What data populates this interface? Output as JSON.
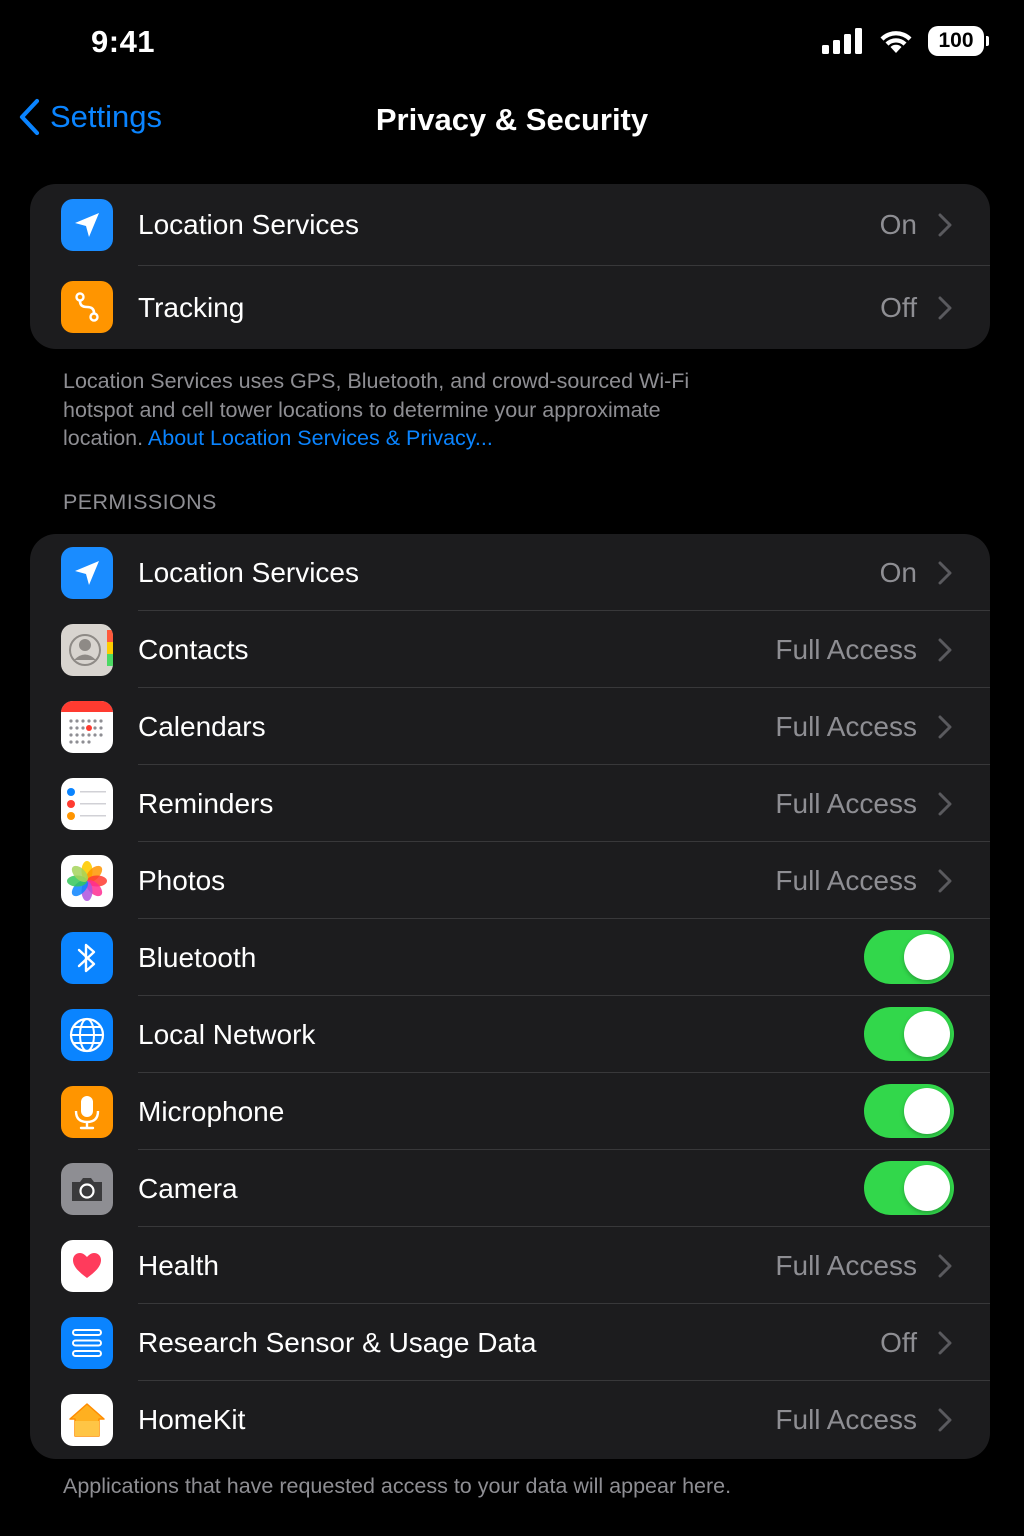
{
  "status_bar": {
    "time": "9:41",
    "battery": "100"
  },
  "nav": {
    "back_label": "Settings",
    "title": "Privacy & Security"
  },
  "top_group": [
    {
      "label": "Location Services",
      "value": "On",
      "icon": "location-arrow-icon",
      "color": "#1a8cff"
    },
    {
      "label": "Tracking",
      "value": "Off",
      "icon": "tracking-icon",
      "color": "#ff9500"
    }
  ],
  "top_footer": {
    "text": "Location Services uses GPS, Bluetooth, and crowd-sourced Wi-Fi hotspot and cell tower locations to determine your approximate location.",
    "link": "About Location Services & Privacy..."
  },
  "permissions_header": "PERMISSIONS",
  "permissions": [
    {
      "label": "Location Services",
      "value": "On",
      "control": "chevron",
      "icon": "location-arrow-icon"
    },
    {
      "label": "Contacts",
      "value": "Full Access",
      "control": "chevron",
      "icon": "contacts-icon"
    },
    {
      "label": "Calendars",
      "value": "Full Access",
      "control": "chevron",
      "icon": "calendar-icon"
    },
    {
      "label": "Reminders",
      "value": "Full Access",
      "control": "chevron",
      "icon": "reminders-icon"
    },
    {
      "label": "Photos",
      "value": "Full Access",
      "control": "chevron",
      "icon": "photos-icon"
    },
    {
      "label": "Bluetooth",
      "control": "toggle",
      "enabled": true,
      "icon": "bluetooth-icon"
    },
    {
      "label": "Local Network",
      "control": "toggle",
      "enabled": true,
      "icon": "globe-icon"
    },
    {
      "label": "Microphone",
      "control": "toggle",
      "enabled": true,
      "icon": "microphone-icon"
    },
    {
      "label": "Camera",
      "control": "toggle",
      "enabled": true,
      "icon": "camera-icon"
    },
    {
      "label": "Health",
      "value": "Full Access",
      "control": "chevron",
      "icon": "health-heart-icon"
    },
    {
      "label": "Research Sensor & Usage Data",
      "value": "Off",
      "control": "chevron",
      "icon": "research-icon"
    },
    {
      "label": "HomeKit",
      "value": "Full Access",
      "control": "chevron",
      "icon": "home-icon"
    }
  ],
  "bottom_footer": "Applications that have requested access to your data will appear here.",
  "colors": {
    "accent": "#0a84ff",
    "toggle_on": "#32d74b",
    "cell_bg": "#1c1c1e",
    "secondary_text": "#8e8e93"
  }
}
